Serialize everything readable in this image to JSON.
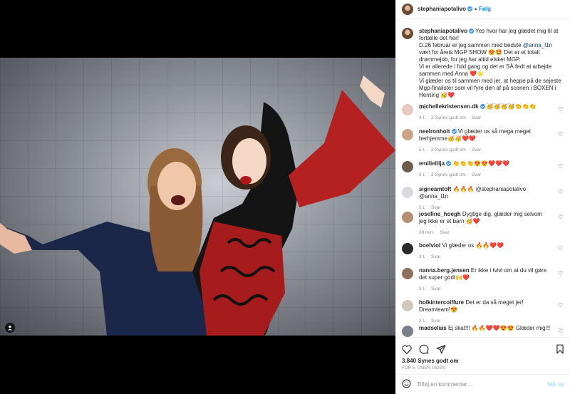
{
  "post": {
    "username": "stephaniapotalivo",
    "follow_label": "Følg",
    "caption_lines": [
      "Yes hvor har jeg glædet mig til at fortælle det her!",
      "D.26 februar er jeg sammen med bedste ",
      " vært for årets MGP SHOW 😍🤩 Det er et totalt drømmejob, for jeg har altid elsket MGP.",
      "Vi er allerede i fuld gang og det er SÅ fedt at arbejde sammen med Anna ❤️🌟",
      "Vi glæder os til sammen med jer, at heppe på de sejeste Mgp-finalister som vil fyre den af på scenen i BOXEN i Herning 🥳❤️"
    ],
    "caption_mention": "@anna_l1n",
    "caption_time": "6 t.",
    "likes": "3.840 Synes godt om",
    "posted_ago": "FOR 6 TIMER SIDEN",
    "comment_placeholder": "Tilføj en kommentar ...",
    "post_button": "Slå op"
  },
  "comments": [
    {
      "user": "michellekristensen.dk",
      "verified": true,
      "text": "🥳🥳🥳🥳👏👏👏",
      "time": "4 t.",
      "likes": "2 Synes godt om",
      "reply": "Svar"
    },
    {
      "user": "neelronholt",
      "verified": true,
      "text": "Vi glæder os så mega meget herhjemme🥳🥳❤️❤️",
      "time": "5 t.",
      "likes": "3 Synes godt om",
      "reply": "Svar"
    },
    {
      "user": "emilielilja",
      "verified": true,
      "text": "👏👏👏😍😍❤️❤️❤️",
      "time": "5 t.",
      "likes": "2 Synes godt om",
      "reply": "Svar"
    },
    {
      "user": "signeamtoft",
      "verified": false,
      "text": "🔥🔥🔥 @stephaniapotalivo @anna_l1n",
      "time": "5 t.",
      "likes": "",
      "reply": "Svar"
    },
    {
      "user": "josefine_hoegh",
      "verified": false,
      "text": "Dygtige dig, glæder mig selvom jeg ikke er et barn 🥳❤️",
      "time": "38 min.",
      "likes": "",
      "reply": "Svar"
    },
    {
      "user": "boelviol",
      "verified": false,
      "text": "Vi glæder os 🔥🔥❤️❤️",
      "time": "3 t.",
      "likes": "",
      "reply": "Svar"
    },
    {
      "user": "nanna.berg.jensen",
      "verified": false,
      "text": "Er ikke i tvivl om at du vil gøre det super godt🙌❤️",
      "time": "3 t.",
      "likes": "",
      "reply": "Svar"
    },
    {
      "user": "holkintercoiffure",
      "verified": false,
      "text": "Det er da så meget jer! Dreamteam!😍",
      "time": "3 t.",
      "likes": "",
      "reply": "Svar"
    },
    {
      "user": "madselias",
      "verified": false,
      "text": "Ej skat!!! 🔥🔥❤️❤️😍😍 Glæder mig!!!",
      "time": "3 t.",
      "likes": "",
      "reply": "Svar"
    }
  ],
  "colors": {
    "accent": "#0095f6",
    "verified": "#3897f0",
    "muted": "#8e8e8e"
  },
  "icons": [
    "heart-icon",
    "comment-icon",
    "share-icon",
    "bookmark-icon",
    "emoji-icon",
    "user-tag-icon"
  ]
}
